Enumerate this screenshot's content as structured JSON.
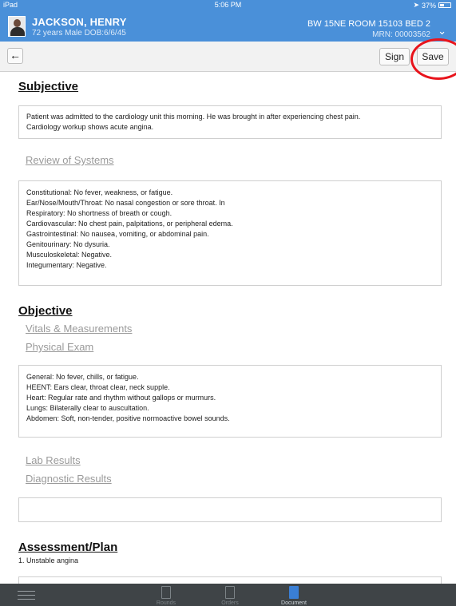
{
  "status_bar": {
    "device": "iPad",
    "time": "5:06 PM",
    "battery": "37%"
  },
  "patient": {
    "name": "JACKSON, HENRY",
    "info": "72 years  Male  DOB:6/6/45",
    "room": "BW 15NE ROOM 15103 BED 2",
    "mrn": "MRN: 00003562"
  },
  "toolbar": {
    "back_icon": "←",
    "sign_label": "Sign",
    "save_label": "Save"
  },
  "subjective": {
    "title": "Subjective",
    "note_lines": [
      "Patient was admitted to the cardiology unit this morning.  He was brought in after experiencing chest pain.",
      "Cardiology workup shows acute angina."
    ],
    "review_of_systems_label": "Review of Systems",
    "ros_lines": [
      "Constitutional:  No fever, weakness, or fatigue.",
      "Ear/Nose/Mouth/Throat:  No nasal congestion or sore throat.  In",
      "Respiratory:  No shortness of breath or cough.",
      "Cardiovascular:  No chest pain, palpitations, or peripheral edema.",
      "Gastrointestinal:  No nausea, vomiting, or abdominal pain.",
      "Genitourinary:  No dysuria.",
      "Musculoskeletal:  Negative.",
      "Integumentary:  Negative."
    ]
  },
  "objective": {
    "title": "Objective",
    "vitals_label": "Vitals & Measurements",
    "physical_exam_label": "Physical Exam",
    "exam_lines": [
      "General:  No fever, chills, or fatigue.",
      "HEENT:  Ears clear, throat clear, neck supple.",
      "Heart:  Regular rate and rhythm without gallops or murmurs.",
      "Lungs:  Bilaterally clear to auscultation.",
      "Abdomen:  Soft, non-tender, positive normoactive bowel sounds."
    ],
    "lab_results_label": "Lab Results",
    "diagnostic_results_label": "Diagnostic Results"
  },
  "assessment": {
    "title": "Assessment/Plan",
    "first_item": "1. Unstable angina"
  },
  "tabbar": {
    "tabs": [
      {
        "label": "Rounds",
        "icon": "clipboard-icon"
      },
      {
        "label": "Orders",
        "icon": "orders-icon"
      },
      {
        "label": "Document",
        "icon": "document-icon"
      }
    ],
    "active_color": "#3a7fd5"
  },
  "colors": {
    "header": "#4a90d9",
    "highlight_circle": "#e8141c"
  }
}
